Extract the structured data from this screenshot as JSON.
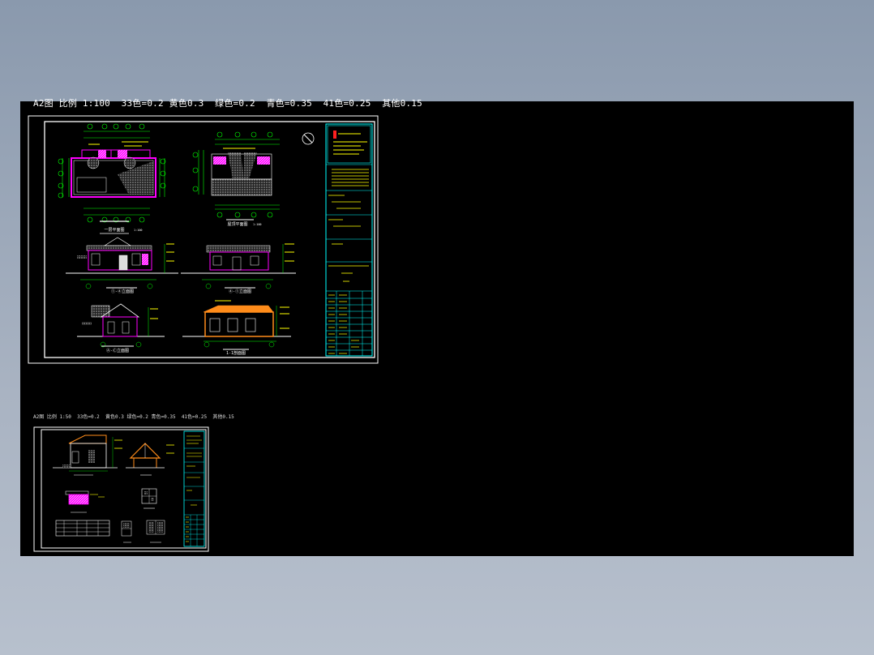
{
  "sheet1": {
    "note": "A2图 比例 1:100  33色=0.2 黄色0.3  绿色=0.2  青色=0.35  41色=0.25  其他0.15",
    "drawings": {
      "plan": "一层平面图",
      "roof": "屋顶平面图",
      "elev1": "①-④立面图",
      "elev2": "④-①立面图",
      "elev3": "Ⓐ-Ⓒ立面图",
      "section": "1-1剖面图",
      "scale": "1:100"
    }
  },
  "sheet2": {
    "note": "A2图 比例 1:50  33色=0.2  黄色0.3 绿色=0.2 青色=0.35  41色=0.25  其他0.15"
  },
  "colors": {
    "background": "#000000",
    "frame": "#ffffff",
    "titleblock": "#00ffff",
    "wall": "#ff00ff",
    "dimension": "#00ff00",
    "hatch": "#c0c0c0",
    "roof": "#ff8c1a",
    "text_yellow": "#ffff00"
  }
}
